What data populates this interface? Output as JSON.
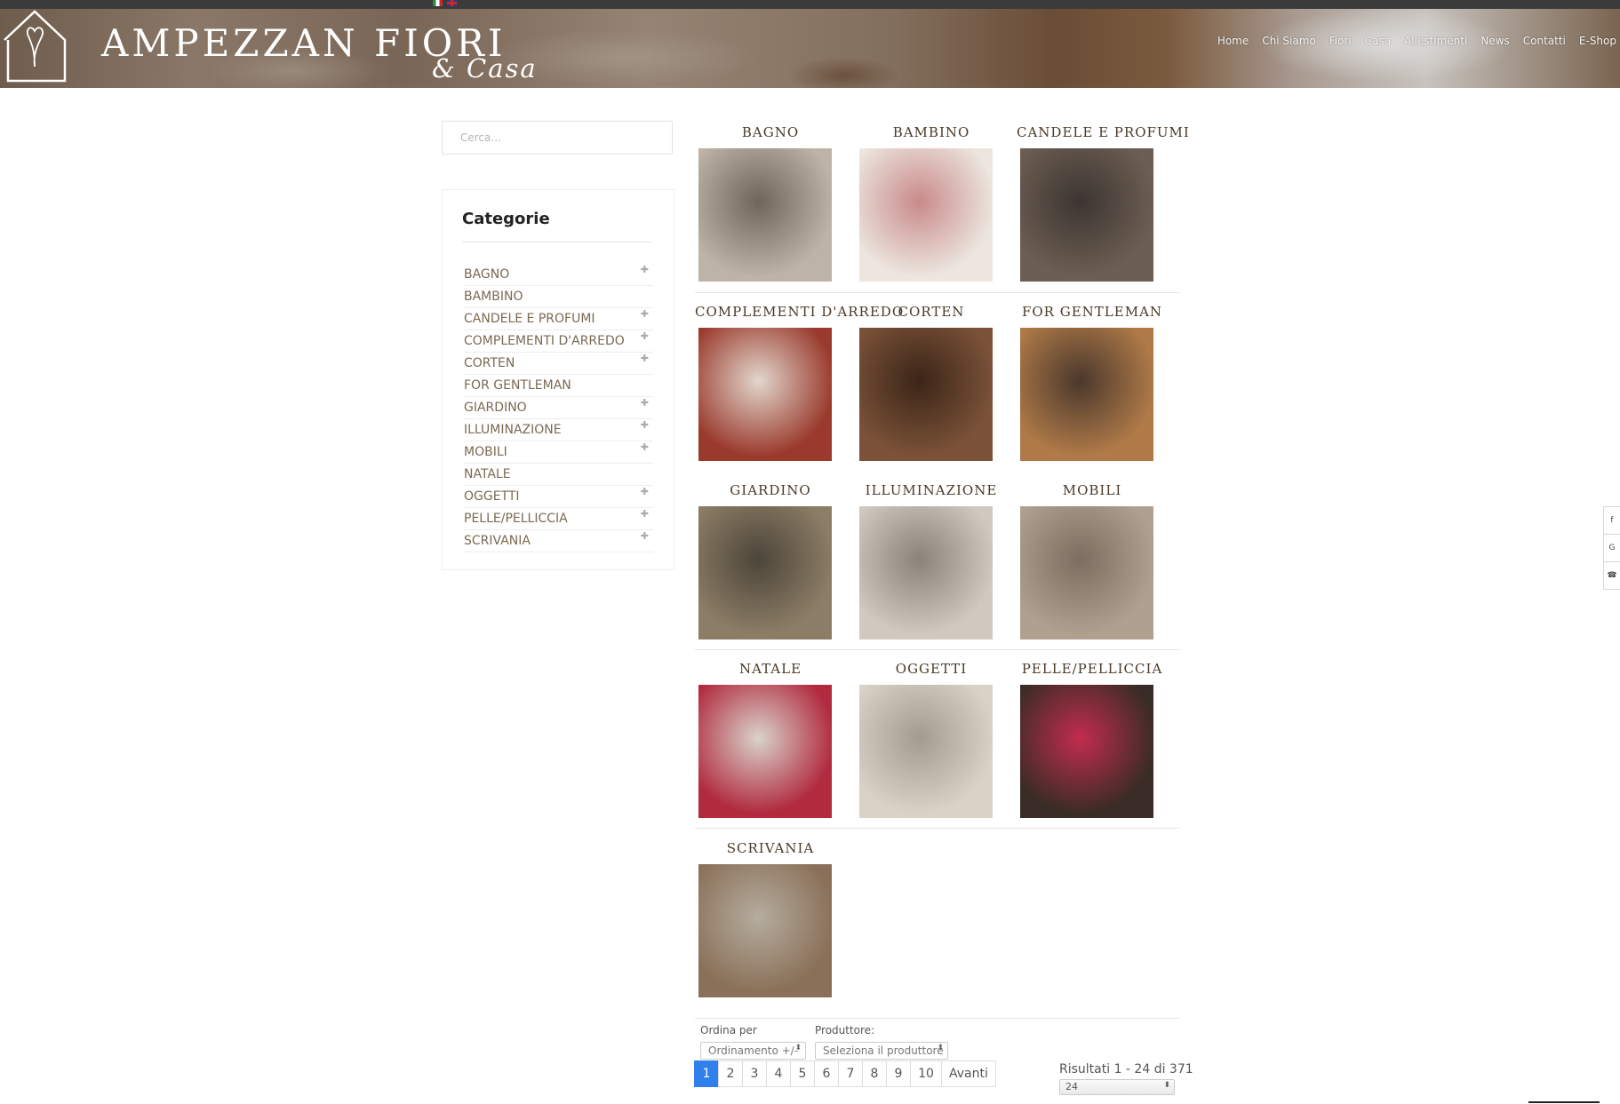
{
  "site": {
    "logo_main": "AMPEZZAN FIORI",
    "logo_sub": "& Casa"
  },
  "nav": [
    "Home",
    "Chi Siamo",
    "Fiori",
    "Casa",
    "Allestimenti",
    "News",
    "Contatti",
    "E-Shop"
  ],
  "search": {
    "placeholder": "Cerca..."
  },
  "sidebar": {
    "title": "Categorie",
    "items": [
      {
        "label": "BAGNO",
        "expandable": true
      },
      {
        "label": "BAMBINO",
        "expandable": false
      },
      {
        "label": "CANDELE E PROFUMI",
        "expandable": true
      },
      {
        "label": "COMPLEMENTI D'ARREDO",
        "expandable": true
      },
      {
        "label": "CORTEN",
        "expandable": true
      },
      {
        "label": "FOR GENTLEMAN",
        "expandable": false
      },
      {
        "label": "GIARDINO",
        "expandable": true
      },
      {
        "label": "ILLUMINAZIONE",
        "expandable": true
      },
      {
        "label": "MOBILI",
        "expandable": true
      },
      {
        "label": "NATALE",
        "expandable": false
      },
      {
        "label": "OGGETTI",
        "expandable": true
      },
      {
        "label": "PELLE/PELLICCIA",
        "expandable": true
      },
      {
        "label": "SCRIVANIA",
        "expandable": true
      }
    ]
  },
  "categories": [
    {
      "title": "BAGNO",
      "colors": [
        "#bdb3a6",
        "#6f655b"
      ]
    },
    {
      "title": "BAMBINO",
      "colors": [
        "#ece6df",
        "#c98a8a"
      ]
    },
    {
      "title": "CANDELE E PROFUMI",
      "colors": [
        "#6c5e52",
        "#3d3532"
      ]
    },
    {
      "title": "COMPLEMENTI D'ARREDO",
      "colors": [
        "#9a3a2d",
        "#e2d6cc"
      ]
    },
    {
      "title": "CORTEN",
      "colors": [
        "#7b5238",
        "#3b2518"
      ]
    },
    {
      "title": "FOR GENTLEMAN",
      "colors": [
        "#b07a48",
        "#4a382c"
      ]
    },
    {
      "title": "GIARDINO",
      "colors": [
        "#8c7d66",
        "#4d453a"
      ]
    },
    {
      "title": "ILLUMINAZIONE",
      "colors": [
        "#cfc9c0",
        "#8b8278"
      ]
    },
    {
      "title": "MOBILI",
      "colors": [
        "#b0a090",
        "#7c6d60"
      ]
    },
    {
      "title": "NATALE",
      "colors": [
        "#b12a3e",
        "#d9d3cb"
      ]
    },
    {
      "title": "OGGETTI",
      "colors": [
        "#d8d2c7",
        "#a39b8f"
      ]
    },
    {
      "title": "PELLE/PELLICCIA",
      "colors": [
        "#3a2c26",
        "#c22c4d"
      ]
    },
    {
      "title": "SCRIVANIA",
      "colors": [
        "#8a7058",
        "#b5ac9f"
      ]
    }
  ],
  "controls": {
    "order_label": "Ordina per",
    "order_value": "Ordinamento +/-",
    "producer_label": "Produttore:",
    "producer_value": "Seleziona il produttore"
  },
  "pagination": {
    "pages": [
      "1",
      "2",
      "3",
      "4",
      "5",
      "6",
      "7",
      "8",
      "9",
      "10"
    ],
    "active": "1",
    "next": "Avanti"
  },
  "results": {
    "text": "Risultati 1 - 24 di 371",
    "per_page": "24"
  },
  "social": [
    "f",
    "G",
    "☎"
  ]
}
